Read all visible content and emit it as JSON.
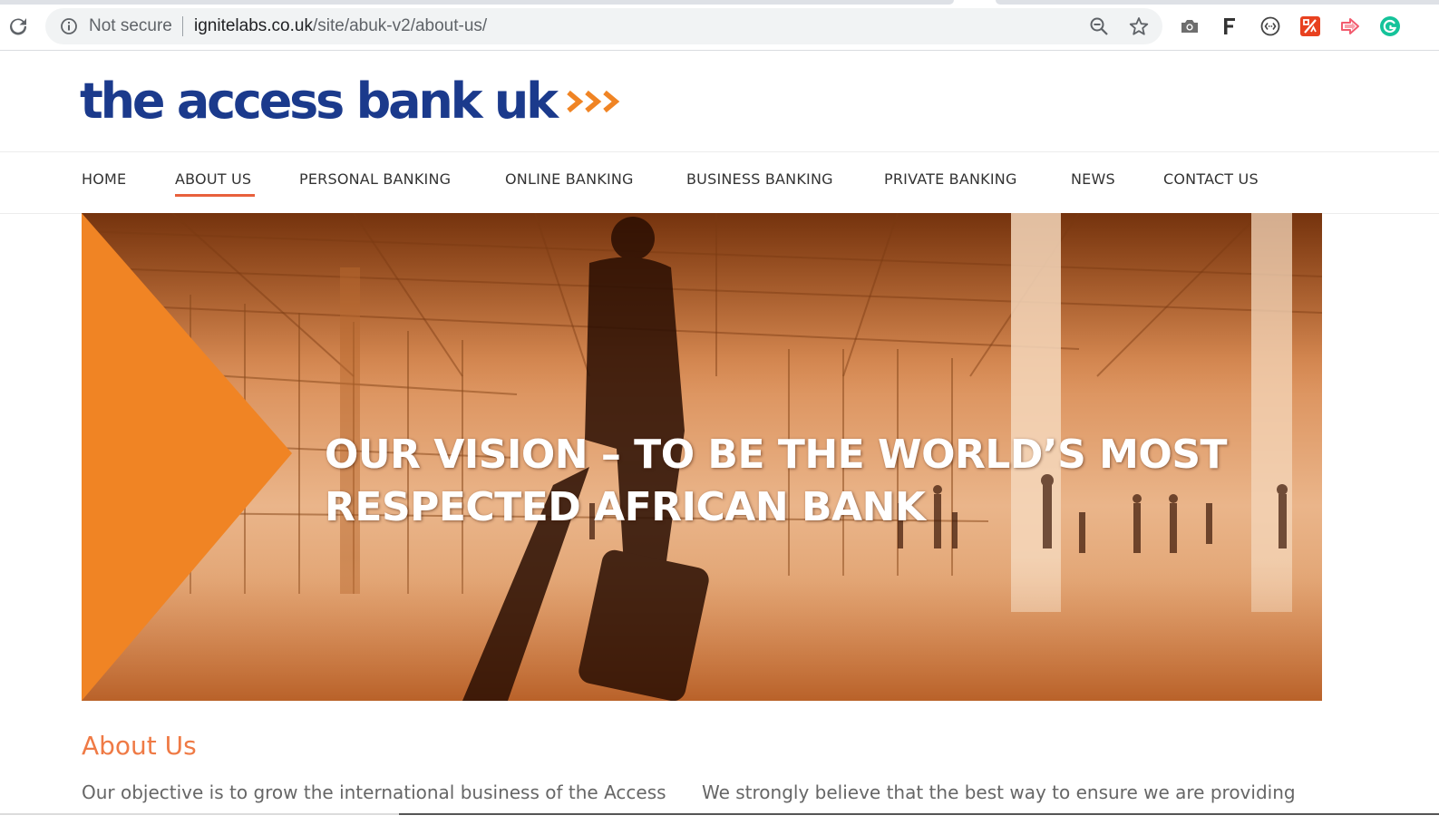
{
  "browser": {
    "security_label": "Not secure",
    "url_host": "ignitelabs.co.uk",
    "url_path": "/site/abuk-v2/about-us/",
    "icons": [
      "reload-icon",
      "info-icon",
      "zoom-icon",
      "star-icon",
      "camera-icon",
      "f-extension-icon",
      "code-extension-icon",
      "percent-extension-icon",
      "arrow-extension-icon",
      "grammarly-icon"
    ]
  },
  "site": {
    "logo_text": "the access bank uk",
    "brand_colors": {
      "navy": "#1b3a8c",
      "orange": "#f08424",
      "heading": "#ef7a45"
    }
  },
  "nav": {
    "items": [
      {
        "label": "HOME"
      },
      {
        "label": "ABOUT US",
        "active": true
      },
      {
        "label": "PERSONAL BANKING"
      },
      {
        "label": "ONLINE BANKING"
      },
      {
        "label": "BUSINESS BANKING"
      },
      {
        "label": "PRIVATE BANKING"
      },
      {
        "label": "NEWS"
      },
      {
        "label": "CONTACT US"
      }
    ]
  },
  "hero": {
    "line1": "OUR VISION – TO BE THE WORLD’S MOST",
    "line2": "RESPECTED AFRICAN BANK"
  },
  "about": {
    "title": "About Us",
    "col1": "Our objective is to grow the international business of the Access",
    "col2": "We strongly believe that the best way to ensure we are providing"
  }
}
